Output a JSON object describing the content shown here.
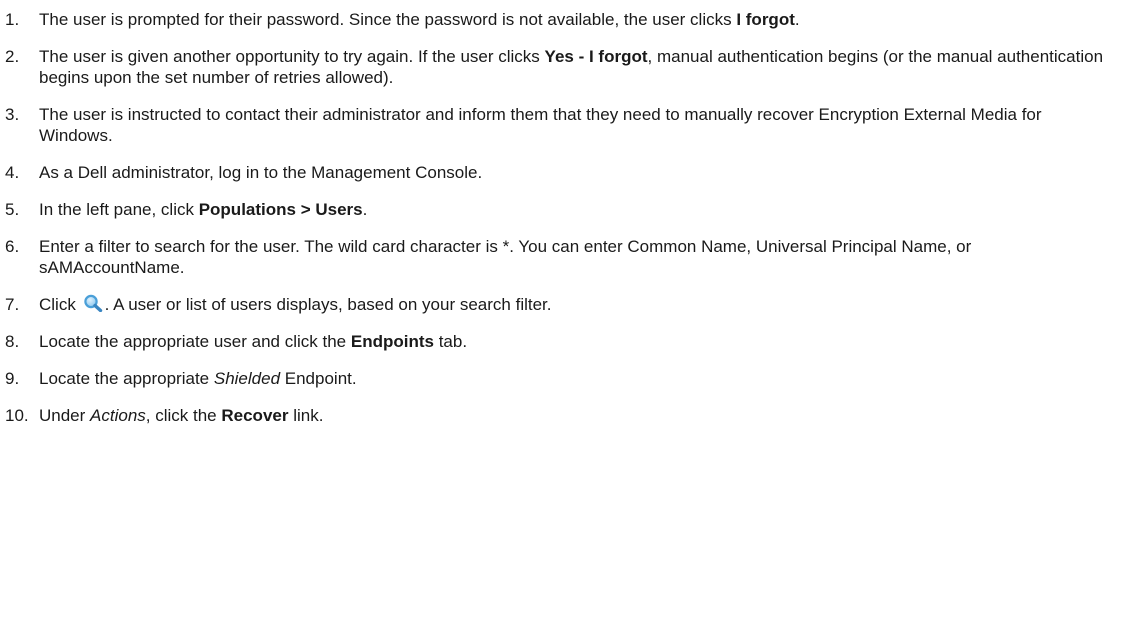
{
  "steps": [
    {
      "num": "1.",
      "t1": "The user is prompted for their password. Since the password is not available, the user clicks ",
      "b1": "I forgot",
      "t2": "."
    },
    {
      "num": "2.",
      "t1": "The user is given another opportunity to try again. If the user clicks ",
      "b1": "Yes - I forgot",
      "t2": ", manual authentication begins (or the manual authentication begins upon the set number of retries allowed)."
    },
    {
      "num": "3.",
      "t1": "The user is instructed to contact their administrator and inform them that they need to manually recover Encryption External Media for Windows."
    },
    {
      "num": "4.",
      "t1": "As a Dell administrator, log in to the Management Console."
    },
    {
      "num": "5.",
      "t1": "In the left pane, click ",
      "b1": "Populations > Users",
      "t2": "."
    },
    {
      "num": "6.",
      "t1": "Enter a filter to search for the user. The wild card character is *. You can enter Common Name, Universal Principal Name, or sAMAccountName."
    },
    {
      "num": "7.",
      "t1": "Click ",
      "icon": "search-icon",
      "t2": ". A user or list of users displays, based on your search filter."
    },
    {
      "num": "8.",
      "t1": "Locate the appropriate user and click the ",
      "b1": "Endpoints",
      "t2": " tab."
    },
    {
      "num": "9.",
      "t1": "Locate the appropriate ",
      "i1": "Shielded",
      "t2": " Endpoint."
    },
    {
      "num": "10.",
      "t1": "Under ",
      "i1": "Actions",
      "t2": ", click the ",
      "b1": "Recover",
      "t3": " link."
    }
  ],
  "colors": {
    "text": "#1a1a1a",
    "search_icon": "#4a9fd8"
  }
}
